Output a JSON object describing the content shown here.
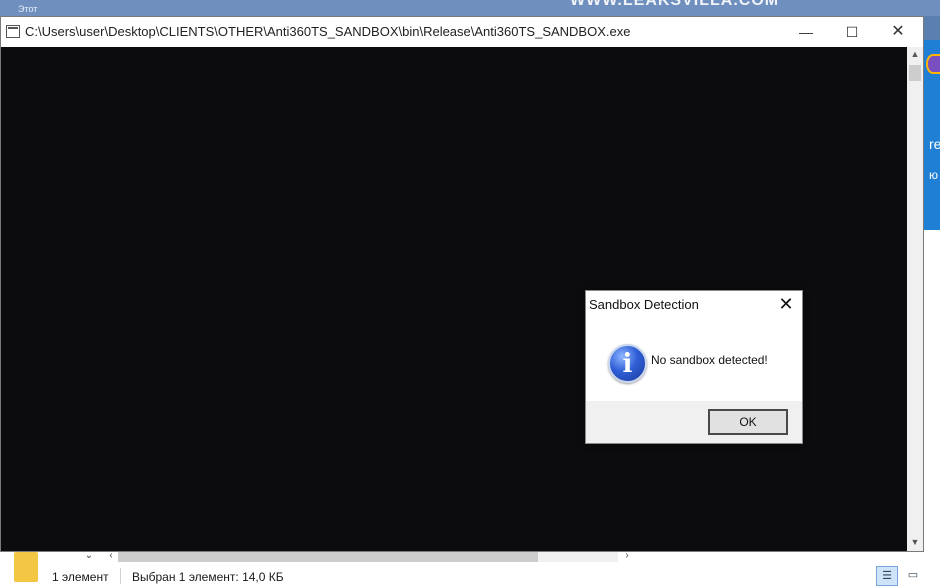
{
  "desktop": {
    "top_label": "Этот",
    "watermark": "WWW.LEAKSVILLA.COM",
    "right_text_1": "re",
    "right_text_2": "ю"
  },
  "console": {
    "title": "C:\\Users\\user\\Desktop\\CLIENTS\\OTHER\\Anti360TS_SANDBOX\\bin\\Release\\Anti360TS_SANDBOX.exe",
    "minimize_glyph": "—",
    "maximize_glyph": "☐",
    "close_glyph": "✕",
    "scroll_up_glyph": "▲",
    "scroll_down_glyph": "▼"
  },
  "msgbox": {
    "title": "Sandbox Detection",
    "close_glyph": "✕",
    "icon": "information-icon",
    "icon_glyph": "i",
    "message": "No sandbox detected!",
    "ok_label": "OK"
  },
  "explorer": {
    "collapse_glyph": "⌄",
    "left_arrow": "‹",
    "right_arrow": "›",
    "item_count": "1 элемент",
    "selected": "Выбран 1 элемент: 14,0 КБ",
    "details_view_glyph": "☰",
    "tiles_view_glyph": "▭"
  },
  "colors": {
    "console_background": "#0c0b0e",
    "info_icon_blue": "#2f5fd6",
    "folder_yellow": "#f3c744"
  }
}
